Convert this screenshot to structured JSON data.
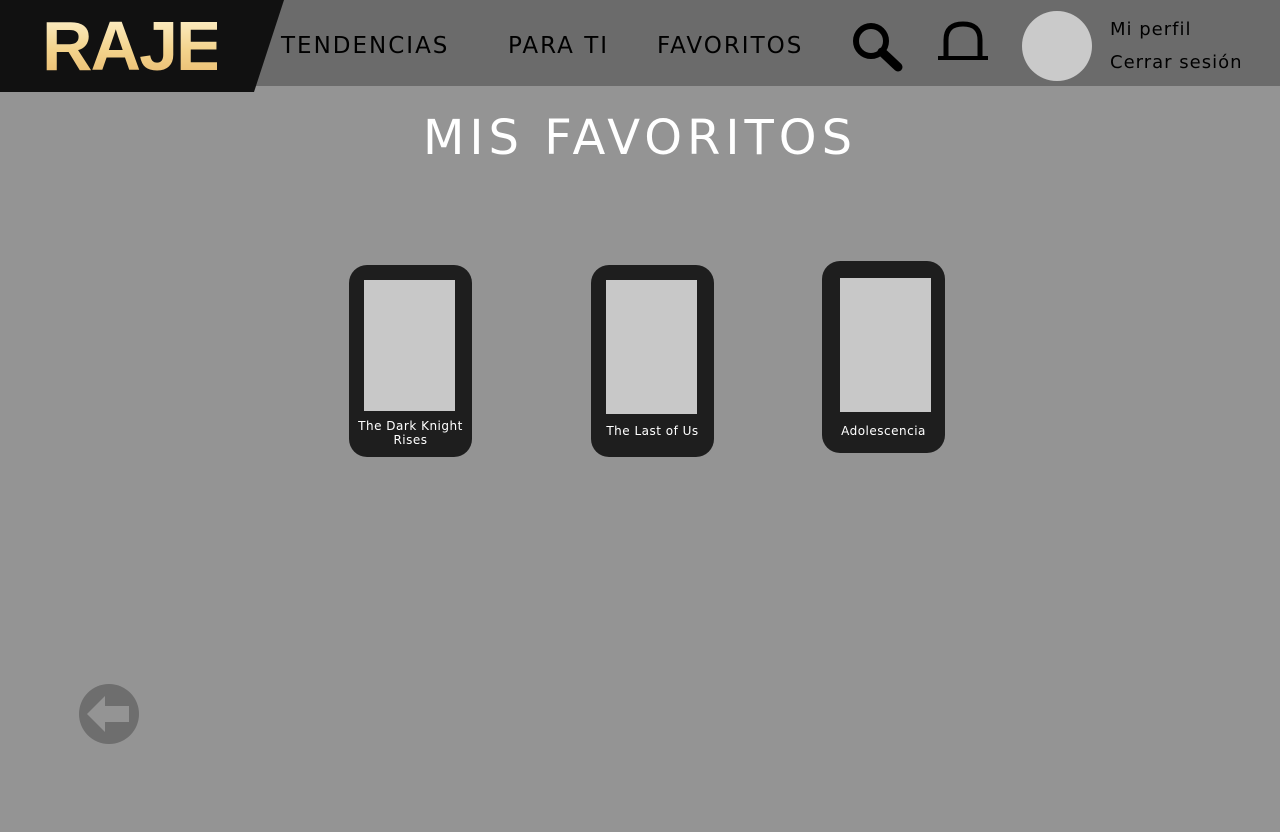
{
  "brand": {
    "logo": "RAJE"
  },
  "nav": {
    "items": [
      {
        "label": "TENDENCIAS"
      },
      {
        "label": "PARA TI"
      },
      {
        "label": "FAVORITOS"
      }
    ]
  },
  "icons": {
    "search": "search-icon",
    "notifications": "bell-icon",
    "back": "arrow-left-icon"
  },
  "user": {
    "profile_label": "Mi perfil",
    "logout_label": "Cerrar sesión"
  },
  "page": {
    "title": "MIS FAVORITOS"
  },
  "favorites": [
    {
      "title": "The Dark Knight Rises"
    },
    {
      "title": "The Last of Us"
    },
    {
      "title": "Adolescencia"
    }
  ],
  "colors": {
    "background": "#949494",
    "header": "#6b6b6b",
    "logo_bg": "#111111",
    "card": "#1e1e1e",
    "poster_placeholder": "#c8c8c8",
    "logo_gold": "#f3d38c"
  }
}
